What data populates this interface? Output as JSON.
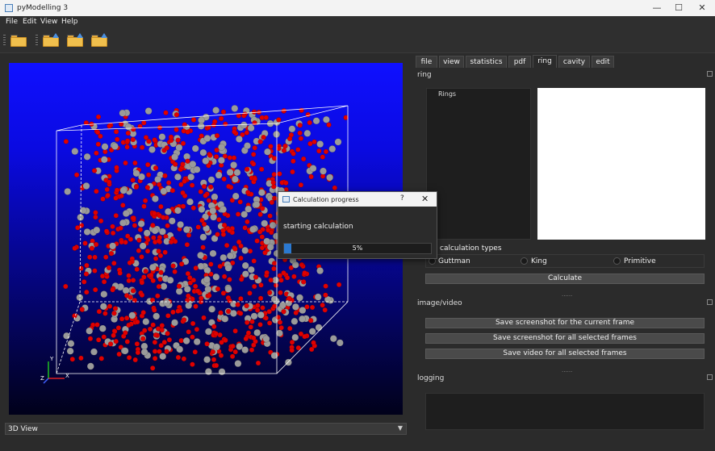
{
  "window": {
    "title": "pyModelling 3",
    "minimize": "—",
    "maximize": "☐",
    "close": "✕"
  },
  "menu": {
    "file": "File",
    "edit": "Edit",
    "view": "View",
    "help": "Help"
  },
  "toolbar": {
    "buttons": [
      "open-folder-icon",
      "open-folder-up-icon",
      "open-folder-up-icon",
      "open-folder-up-icon"
    ]
  },
  "viewport": {
    "background_top": "#0f10ff",
    "background_bottom": "#01011a",
    "atom_colors": {
      "oxygen": "#e00000",
      "silicon": "#9a9a9a"
    },
    "axes": {
      "x": "X",
      "y": "Y",
      "z": "Z"
    }
  },
  "view_select": {
    "value": "3D View"
  },
  "tabs": [
    "file",
    "view",
    "statistics",
    "pdf",
    "ring",
    "cavity",
    "edit"
  ],
  "active_tab": "ring",
  "ring_panel": {
    "title": "ring",
    "list_header": "Rings",
    "calc_types_title": "calculation types",
    "types": [
      "Guttman",
      "King",
      "Primitive"
    ],
    "calculate": "Calculate"
  },
  "image_panel": {
    "title": "image/video",
    "buttons": [
      "Save screenshot for the current frame",
      "Save screenshot for all selected frames",
      "Save video for all selected frames"
    ]
  },
  "logging_panel": {
    "title": "logging"
  },
  "separator": "......",
  "dialog": {
    "title": "Calculation progress",
    "help": "?",
    "close": "✕",
    "message": "starting calculation",
    "progress_text": "5%",
    "progress": 0.05
  }
}
